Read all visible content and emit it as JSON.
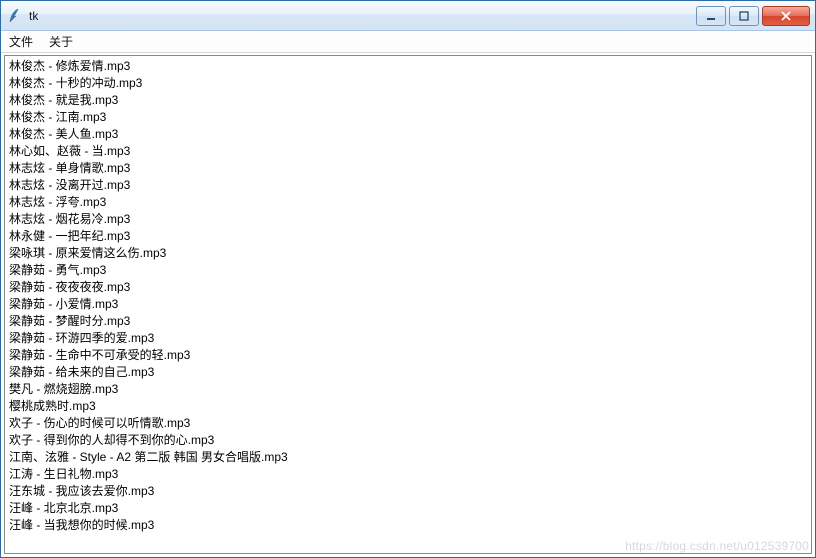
{
  "window": {
    "title": "tk",
    "icon_name": "tk-feather-icon"
  },
  "menubar": {
    "items": [
      {
        "label": "文件"
      },
      {
        "label": "关于"
      }
    ]
  },
  "listbox": {
    "items": [
      "林俊杰 - 修炼爱情.mp3",
      "林俊杰 - 十秒的冲动.mp3",
      "林俊杰 - 就是我.mp3",
      "林俊杰 - 江南.mp3",
      "林俊杰 - 美人鱼.mp3",
      "林心如、赵薇 - 当.mp3",
      "林志炫 - 单身情歌.mp3",
      "林志炫 - 没离开过.mp3",
      "林志炫 - 浮夸.mp3",
      "林志炫 - 烟花易冷.mp3",
      "林永健 - 一把年纪.mp3",
      "梁咏琪 - 原来爱情这么伤.mp3",
      "梁静茹 - 勇气.mp3",
      "梁静茹 - 夜夜夜夜.mp3",
      "梁静茹 - 小爱情.mp3",
      "梁静茹 - 梦醒时分.mp3",
      "梁静茹 - 环游四季的爱.mp3",
      "梁静茹 - 生命中不可承受的轻.mp3",
      "梁静茹 - 给未来的自己.mp3",
      "樊凡 - 燃烧翅膀.mp3",
      "樱桃成熟时.mp3",
      "欢子 - 伤心的时候可以听情歌.mp3",
      "欢子 - 得到你的人却得不到你的心.mp3",
      "江南、泫雅 - Style - A2 第二版 韩国 男女合唱版.mp3",
      "江涛 - 生日礼物.mp3",
      "汪东城 - 我应该去爱你.mp3",
      "汪峰 - 北京北京.mp3",
      "汪峰 - 当我想你的时候.mp3"
    ]
  },
  "watermark": "https://blog.csdn.net/u012539700"
}
